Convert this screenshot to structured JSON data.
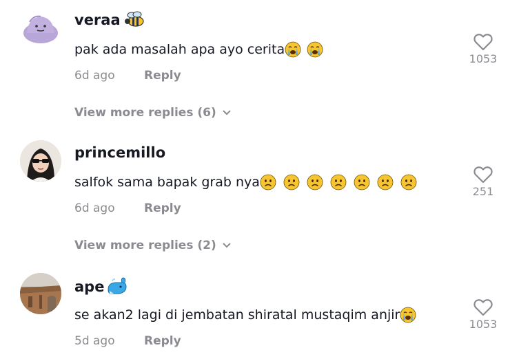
{
  "comments": [
    {
      "username": "veraa",
      "username_emoji": "bee-icon",
      "text": "pak ada masalah apa ayo cerita",
      "text_emojis": [
        "loudly-crying-face-icon",
        "loudly-crying-face-icon"
      ],
      "time": "6d ago",
      "reply_label": "Reply",
      "likes": "1053",
      "more_replies": "View more replies (6)"
    },
    {
      "username": "princemillo",
      "text": "salfok sama bapak grab nya",
      "text_emojis": [
        "frowning-face-icon",
        "frowning-face-icon",
        "frowning-face-icon",
        "frowning-face-icon",
        "frowning-face-icon",
        "frowning-face-icon",
        "frowning-face-icon"
      ],
      "time": "6d ago",
      "reply_label": "Reply",
      "likes": "251",
      "more_replies": "View more replies (2)"
    },
    {
      "username": "ape",
      "username_emoji": "whale-icon",
      "text": "se akan2 lagi di jembatan shiratal mustaqim anjir",
      "text_emojis": [
        "loudly-crying-face-icon"
      ],
      "time": "5d ago",
      "reply_label": "Reply",
      "likes": "1053"
    }
  ],
  "colors": {
    "text_primary": "#161823",
    "text_secondary": "#8a8b91",
    "emoji_yellow": "#f7c531"
  }
}
